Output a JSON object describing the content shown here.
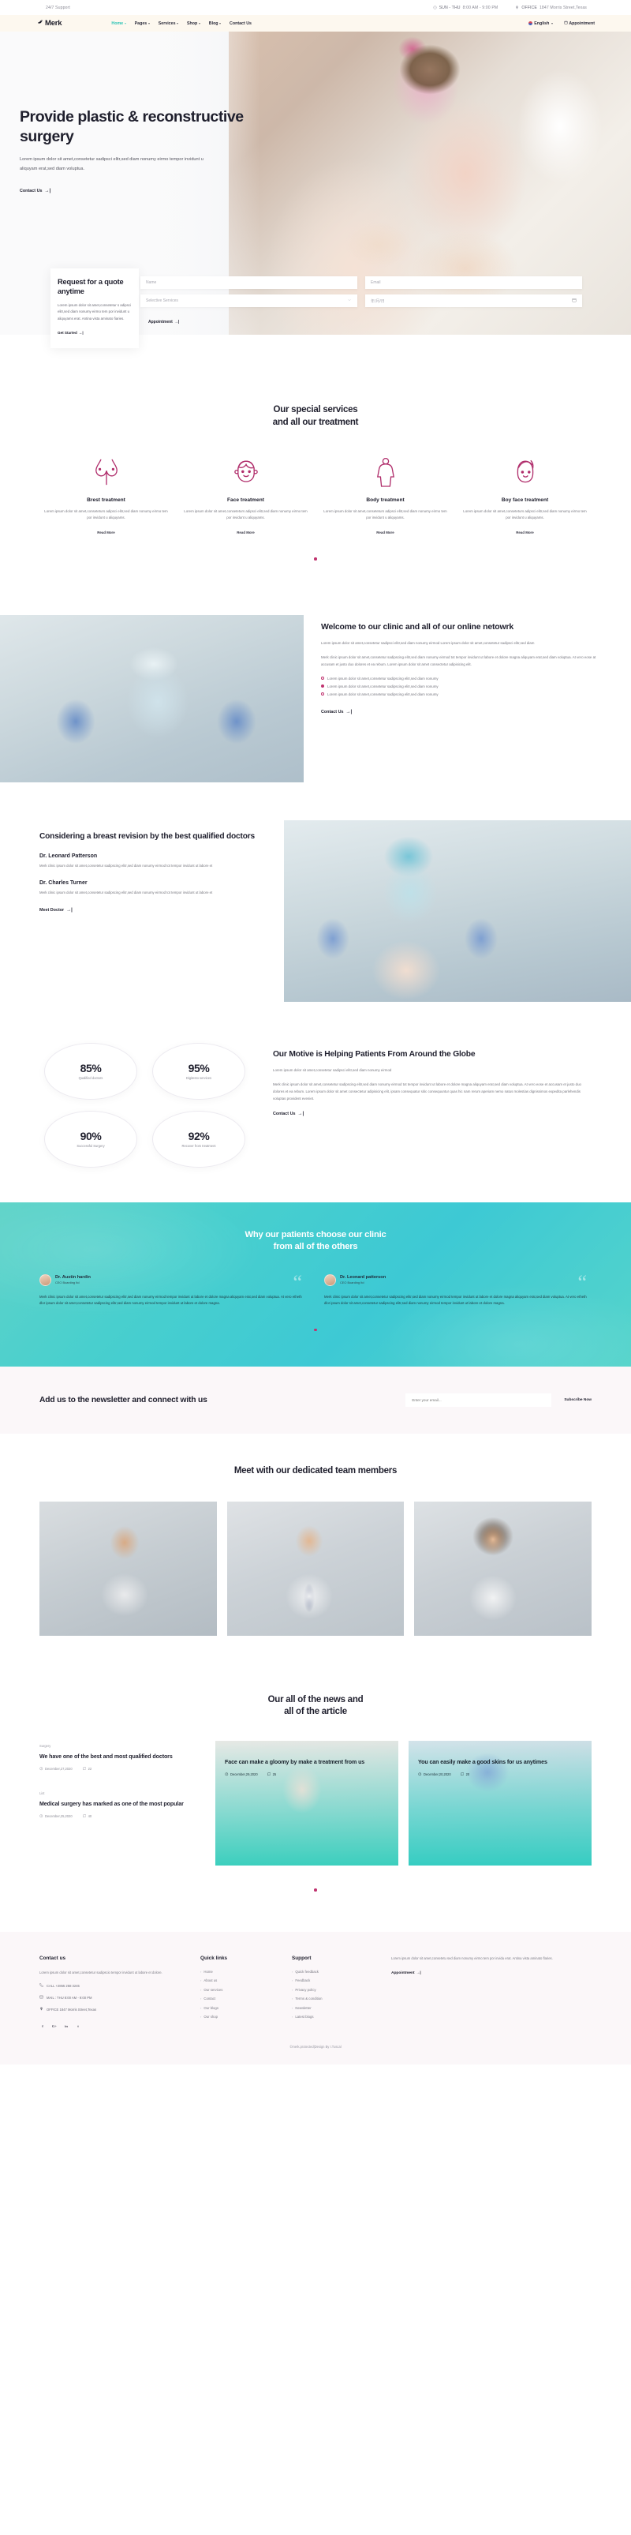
{
  "topbar": {
    "support": "24/7 Support",
    "hours_icon": "clock-icon",
    "hours_label": "SUN - THU",
    "hours_value": "8:00 AM - 9:00 PM",
    "office_icon": "location-pin-icon",
    "office_label": "OFFICE",
    "office_value": "1847 Morris Street,Texas"
  },
  "nav": {
    "logo": "Merk",
    "logo_icon": "bird-leaf-icon",
    "items": [
      {
        "label": "Home",
        "caret": true,
        "active": true
      },
      {
        "label": "Pages",
        "caret": true,
        "active": false
      },
      {
        "label": "Services",
        "caret": true,
        "active": false
      },
      {
        "label": "Shop",
        "caret": true,
        "active": false
      },
      {
        "label": "Blog",
        "caret": true,
        "active": false
      },
      {
        "label": "Contact Us",
        "caret": false,
        "active": false
      }
    ],
    "language": "English",
    "appointment": "Appointment",
    "accent": "#2ec4b6"
  },
  "hero": {
    "title": "Provide plastic & reconstructive surgery",
    "paragraph": "Lorem ipsum dolor sit amet,consetetur sadipsci elitr,sed diam nonumy eirmo tempor invidunt u aliquyam erat,sed diam voluptua.",
    "cta": "Contact Us"
  },
  "quote": {
    "title": "Request for a quote anytime",
    "paragraph": "Lorem ipsum dolor sit amet,consetetur s adipsci elitr,sed diam nonumy eirmo tem por invidunt u aliquyams erat. Antina vista aminato fiaries.",
    "cta": "Get Started",
    "form": {
      "name_placeholder": "Name",
      "email_placeholder": "Email",
      "service_value": "Selective Services",
      "date_value": "年/月/日",
      "submit": "Appointment"
    }
  },
  "services": {
    "title_line1": "Our special services",
    "title_line2": "and all our treatment",
    "read_more": "Read More",
    "accent": "#c0336f",
    "items": [
      {
        "icon": "breast-outline-icon",
        "name": "Brest treatment",
        "desc": "Lorem ipsum dolor sit amet,conseteturs adipsci elitr,sed diam nonumy eirmo tem por invidunt u aliquyams."
      },
      {
        "icon": "face-outline-icon",
        "name": "Face treatment",
        "desc": "Lorem ipsum dolor sit amet,conseteturs adipsci elitr,sed diam nonumy eirmo tem por invidunt u aliquyams."
      },
      {
        "icon": "body-outline-icon",
        "name": "Body treatment",
        "desc": "Lorem ipsum dolor sit amet,conseteturs adipsci elitr,sed diam nonumy eirmo tem por invidunt u aliquyams."
      },
      {
        "icon": "boy-face-outline-icon",
        "name": "Boy face treatment",
        "desc": "Lorem ipsum dolor sit amet,conseteturs adipsci elitr,sed diam nonumy eirmo tem por invidunt u aliquyams."
      }
    ]
  },
  "welcome": {
    "title": "Welcome to our clinic and all of our online netowrk",
    "p1": "Lorem ipsum dolor sit amet,consetetur sadipsci elitr,sed diam nonumy eirmod Lorem ipsum dolor sit amet,consetetur sadipsci elitr,sed diam",
    "p2": "Merk clinic ipsum dolor sit amet,consetetur sadipscing elitr,sed diam nonumy eirmod tot tempor invidunt ut labore et dolore magna aliquyam erat,sed diam voluptua. At vero eose at accusam et justo duo dolores et ea rebum. Lorem ipsum dolor sit amet consectetur adipisicing elit.",
    "bullets": [
      {
        "text": "Lorem ipsum dolor sit amet,consetetur sadipscing elitr,sed diam nonumy",
        "active": false
      },
      {
        "text": "Lorem ipsum dolor sit amet,consetetur sadipscing elitr,sed diam nonumy",
        "active": true
      },
      {
        "text": "Lorem ipsum dolor sit amet,consetetur sadipscing elitr,sed diam nonumy",
        "active": false
      }
    ],
    "cta": "Contact Us"
  },
  "doctors": {
    "title": "Considering a breast revision by the best qualified doctors",
    "cta": "Meet Doctor",
    "list": [
      {
        "name": "Dr. Leonard Patterson",
        "desc": "Merk clinic ipsum dolor sit amet,consetetur sadipscing elitr,sed diam nonumy eirmod tot tempor invidunt ut labore et"
      },
      {
        "name": "Dr. Charles Turner",
        "desc": "Merk clinic ipsum dolor sit amet,consetetur sadipscing elitr,sed diam nonumy eirmod tot tempor invidunt ut labore et"
      }
    ]
  },
  "stats": {
    "title": "Our Motive is Helping Patients From Around the Globe",
    "p1": "Lorem ipsum dolor sit amet,consetetur sadipsci elitr,sed diam nonumy eirmod",
    "p2": "Merk clinic ipsum dolor sit amet,consetetur sadipscing elitr,sed diam nonumy eirmod tot tempor invidunt ut labore et dolore magna aliquyam erat,sed diam voluptua. At vero eose et accusam et justo duo dolores et ea rebum. Lorem ipsum dolor sit amet consectetur adipisicing elit, ipsam consequatur sitic consequuntur quas hic nam rerum aperiam nemo natus molestias dignissimos expedita parlehendis voluptas provident eveniet.",
    "cta": "Contact Us",
    "items": [
      {
        "value": "85%",
        "label": "Qualified doctors"
      },
      {
        "value": "95%",
        "label": "Digitesto services"
      },
      {
        "value": "90%",
        "label": "Successful Surgery"
      },
      {
        "value": "92%",
        "label": "Recover from treatment"
      }
    ]
  },
  "testimonials": {
    "title_line1": "Why our patients choose our clinic",
    "title_line2": "from all of the others",
    "quote_glyph": "“",
    "items": [
      {
        "name": "Dr. Austin hardin",
        "role": "CEO Boarding Itd",
        "text": "Merk clinic ipsum dolor sit amet,consetetur sadipscing elitr,sed diam nonumy eirmod tempor invidunt ut labore et dolore magna aliquyam erat,sed diam voluptua. At vero etheth dlor ipsum dolor sit amet,consetetur sadipscing elitr,sed diam nonumy eirmod tempor invidunt ut labore et dolore magna."
      },
      {
        "name": "Dr. Leonard patterson",
        "role": "CEO Boarding Itd",
        "text": "Merk clinic ipsum dolor sit amet,consetetur sadipscing elitr,sed diam nonumy eirmod tempor invidunt ut labore et dolore magna aliquyam erat,sed diam voluptua. At vero etheth dlor ipsum dolor sit amet,consetetur sadipscing elitr,sed diam nonumy eirmod tempor invidunt ut labore et dolore magna."
      }
    ]
  },
  "newsletter": {
    "title": "Add us to the newsletter and connect with us",
    "placeholder": "Enter your email...",
    "button": "Subscribe Now"
  },
  "team": {
    "title": "Meet with our dedicated team members",
    "members": [
      {
        "photo": "doctor-bearded-portrait"
      },
      {
        "photo": "doctor-smiling-portrait"
      },
      {
        "photo": "doctor-female-portrait"
      }
    ]
  },
  "blog": {
    "title_line1": "Our all of the news and",
    "title_line2": "all of the article",
    "left_items": [
      {
        "category": "Surgery",
        "title": "We have one of the best and most qualified doctors",
        "date": "December,27,2020",
        "comments": "22"
      },
      {
        "category": "List",
        "title": "Medical surgery has marked as one of the most popular",
        "date": "December,25,2020",
        "comments": "40"
      }
    ],
    "cards": [
      {
        "title": "Face can make a gloomy by make a treatment from us",
        "date": "December,29,2020",
        "comments": "25"
      },
      {
        "title": "You can easily make a good skins for us anytimes",
        "date": "December,20,2020",
        "comments": "20"
      }
    ]
  },
  "footer": {
    "contact": {
      "heading": "Contact us",
      "text": "Lorem ipsum dolor sit amet,consetetur sadipscio tempor invidunt ut labore et dolore.",
      "phone": "CALL +2855 258 3245",
      "email": "MAIL : THU 8:00 AM - 9:00 PM",
      "office": "OFFICE 1847 Morris Street,Texas",
      "socials": [
        "f",
        "G+",
        "in",
        "t"
      ]
    },
    "quick": {
      "heading": "Quick links",
      "items": [
        "Home",
        "About us",
        "Our services",
        "Contact",
        "Our blogs",
        "Our shop"
      ]
    },
    "support": {
      "heading": "Support",
      "items": [
        "Quick feedback",
        "Feedback",
        "Privacy policy",
        "Terms & condition",
        "Newsletter",
        "Latest blogs"
      ]
    },
    "appt": {
      "text": "Lorem ipsum dolor sit amet,consetetu sed diam nonumy eirmo tem por invidu erat. Antina vista aminato flaries.",
      "button": "Appointment"
    },
    "copyright": "©merk.protected|Design By I.Tuscal"
  }
}
